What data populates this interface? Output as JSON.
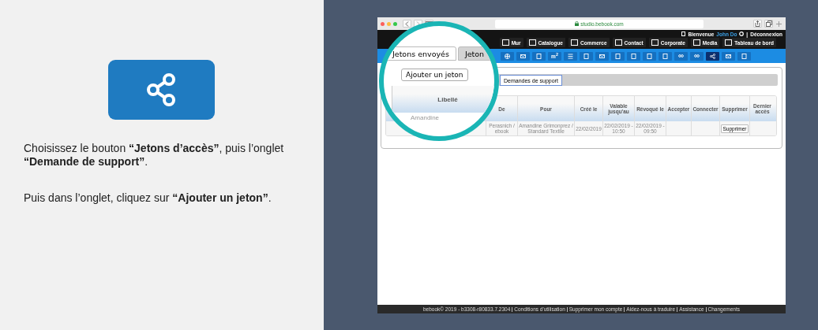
{
  "instructions": {
    "paragraphs": [
      "Choisissez le bouton **“Jetons d’accès”**, puis l’onglet **“Demande de support”**.",
      "Puis dans l’onglet, cliquez sur **“Ajouter un jeton”**."
    ]
  },
  "browser": {
    "url": "studio.bebook.com",
    "welcome": {
      "greeting": "Bienvenue",
      "user": "John Do",
      "separator": "|",
      "logout": "Déconnexion"
    },
    "nav_items": [
      {
        "label": "Mur"
      },
      {
        "label": "Catalogue"
      },
      {
        "label": "Commerce"
      },
      {
        "label": "Contact"
      },
      {
        "label": "Corporate"
      },
      {
        "label": "Media"
      },
      {
        "label": "Tableau de bord"
      }
    ],
    "toolbar": [
      {
        "kind": "icon",
        "selected": false
      },
      {
        "kind": "icon",
        "selected": false
      },
      {
        "kind": "icon",
        "selected": false
      },
      {
        "kind": "text",
        "label": "m$^{2}$",
        "selected": false
      },
      {
        "kind": "icon",
        "selected": false
      },
      {
        "kind": "icon",
        "selected": false
      },
      {
        "kind": "icon",
        "selected": false
      },
      {
        "kind": "icon",
        "selected": false
      },
      {
        "kind": "icon",
        "selected": false
      },
      {
        "kind": "icon",
        "selected": false
      },
      {
        "kind": "icon",
        "selected": false
      },
      {
        "kind": "icon",
        "selected": false
      },
      {
        "kind": "icon",
        "selected": false
      },
      {
        "kind": "icon",
        "selected": true
      },
      {
        "kind": "icon",
        "selected": false
      },
      {
        "kind": "icon",
        "selected": false
      }
    ],
    "subtabs": [
      {
        "label": "Demandes de support",
        "selected": true
      }
    ],
    "table": {
      "columns": [
        "De",
        "Pour",
        "Créé le",
        "Valable jusqu'au",
        "Révoqué le",
        "Accepter",
        "Connecter",
        "Supprimer",
        "Dernier accès"
      ],
      "rows": [
        {
          "cells": [
            "Perasnich / ebook",
            "Amandine Grimonprez / Standard Textile",
            "22/02/2019",
            "22/02/2019 - 10:50",
            "22/02/2019 - 09:50",
            "",
            "",
            "",
            ""
          ],
          "action": "Supprimer"
        }
      ]
    },
    "footer": [
      "bebook© 2019 - b3308-r80833.7.2304",
      "Conditions d'utilisation",
      "Supprimer mon compte",
      "Aidez-nous à traduire",
      "Assistance",
      "Changements"
    ]
  },
  "magnifier": {
    "tabs": [
      {
        "label": "Jetons envoyés",
        "selected": true
      },
      {
        "label": "Jeton",
        "selected": false
      }
    ],
    "button": "Ajouter un jeton",
    "column": "Libellé",
    "cell": "Amandine"
  }
}
